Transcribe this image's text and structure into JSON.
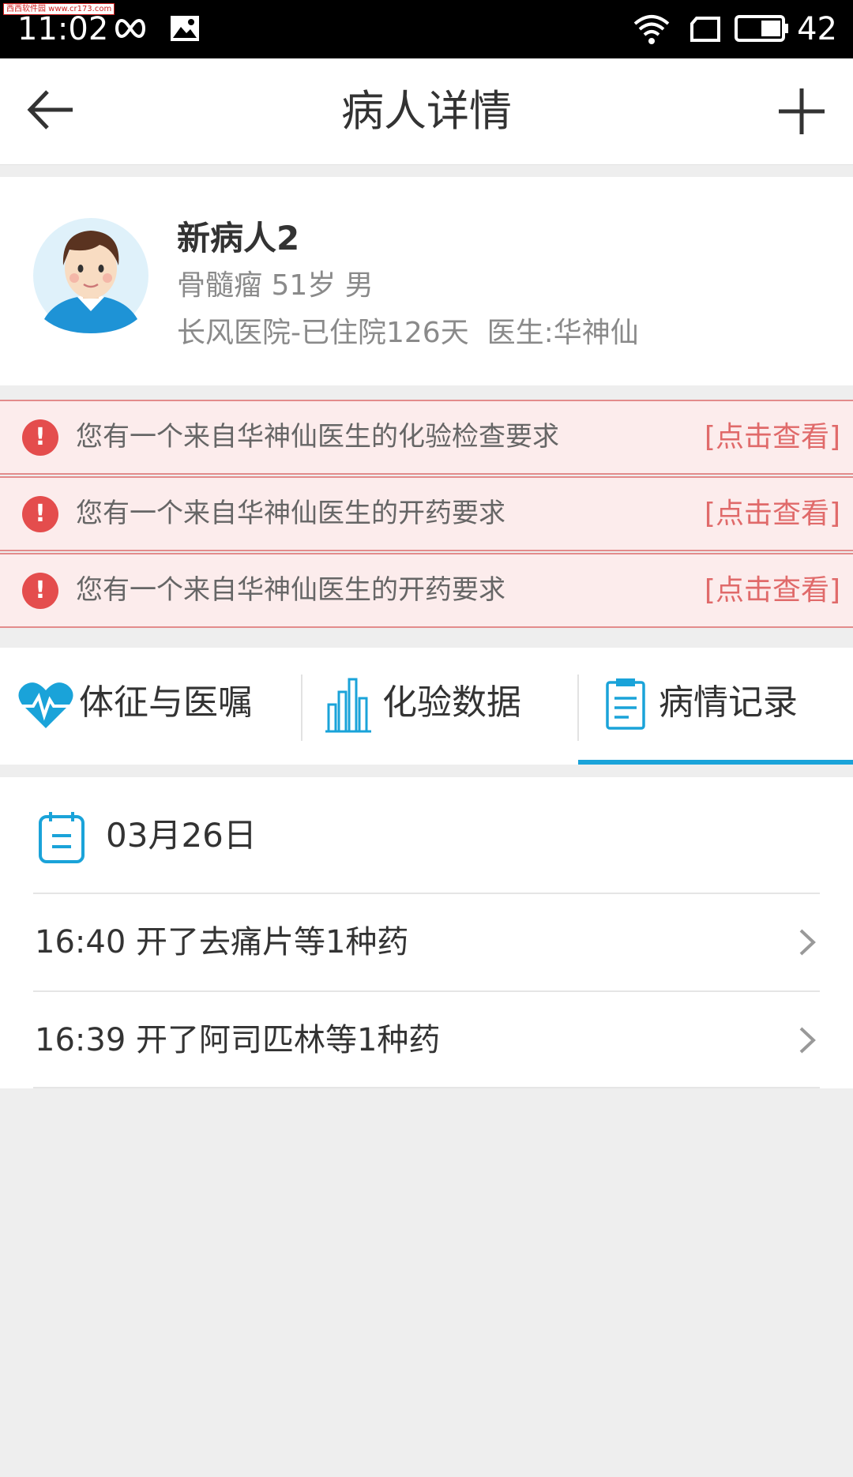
{
  "status_bar": {
    "watermark": "西西软件园 www.cr173.com",
    "time": "11:02",
    "battery": "42"
  },
  "header": {
    "title": "病人详情"
  },
  "patient": {
    "name": "新病人2",
    "info": "骨髓瘤 51岁 男",
    "hospital_line": "长风医院-已住院126天  医生:华神仙"
  },
  "alerts": [
    {
      "text": "您有一个来自华神仙医生的化验检查要求",
      "link": "[点击查看]"
    },
    {
      "text": "您有一个来自华神仙医生的开药要求",
      "link": "[点击查看]"
    },
    {
      "text": "您有一个来自华神仙医生的开药要求",
      "link": "[点击查看]"
    }
  ],
  "tabs": [
    {
      "label": "体征与医嘱",
      "icon": "heartbeat-icon"
    },
    {
      "label": "化验数据",
      "icon": "bar-chart-icon"
    },
    {
      "label": "病情记录",
      "icon": "clipboard-icon",
      "active": true
    }
  ],
  "records": {
    "date": "03月26日",
    "items": [
      {
        "text": "16:40 开了去痛片等1种药"
      },
      {
        "text": "16:39 开了阿司匹林等1种药"
      }
    ]
  },
  "colors": {
    "accent": "#1aa3d9",
    "alert_bg": "#fcecec",
    "alert_border": "#e38b8b",
    "alert_icon": "#e44d4d",
    "alert_link": "#e06a6a"
  }
}
